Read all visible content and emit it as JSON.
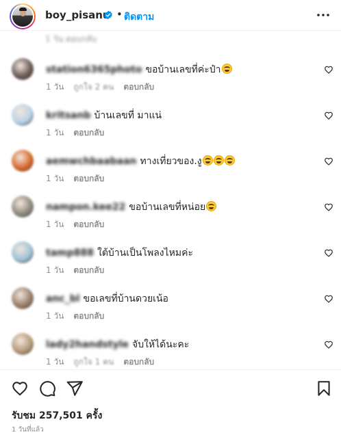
{
  "header": {
    "username": "boy_pisanu",
    "separator": "•",
    "follow_label": "ติดตาม"
  },
  "partial_row": {
    "text": "1 วัน   ตอบกลับ"
  },
  "comments": [
    {
      "username": "station6365photo",
      "text": "ขอบ้านเลขที่ค่ะป๋า",
      "emoji_count": 1,
      "emoji": "heart-eyes-emoji",
      "time": "1 วัน",
      "likes": "ถูกใจ 2 คน",
      "reply": "ตอบกลับ",
      "avatar_color": "#6b5a56"
    },
    {
      "username": "kritsanb",
      "text": "บ้านเลขที่ มาแน่",
      "emoji_count": 0,
      "time": "1 วัน",
      "likes": "",
      "reply": "ตอบกลับ",
      "avatar_color": "#b9d3ea"
    },
    {
      "username": "aemwchbaabaan",
      "text": "ทางเที่ยวของ.งู",
      "emoji_count": 3,
      "emoji": "laughing-emoji",
      "time": "1 วัน",
      "likes": "",
      "reply": "ตอบกลับ",
      "avatar_color": "#d9692a"
    },
    {
      "username": "nampon.kee22",
      "text": "ขอบ้านเลขที่หน่อย",
      "emoji_count": 1,
      "emoji": "laughing-emoji",
      "time": "1 วัน",
      "likes": "",
      "reply": "ตอบกลับ",
      "avatar_color": "#8f8a7e"
    },
    {
      "username": "tamp888",
      "text": "ใต้บ้านเป็นโพลงไหมค่ะ",
      "emoji_count": 0,
      "time": "1 วัน",
      "likes": "",
      "reply": "ตอบกลับ",
      "avatar_color": "#9dc3d6"
    },
    {
      "username": "anc_bl",
      "text": "ขอเลขที่บ้านดวยเน้อ",
      "emoji_count": 0,
      "time": "1 วัน",
      "likes": "",
      "reply": "ตอบกลับ",
      "avatar_color": "#9a7f6a"
    },
    {
      "username": "lady2handstyle",
      "text": "จับให้ได้นะคะ",
      "emoji_count": 0,
      "time": "1 วัน",
      "likes": "ถูกใจ 1 คน",
      "reply": "ตอบกลับ",
      "avatar_color": "#b59a78"
    }
  ],
  "footer": {
    "views": "รับชม 257,501 ครั้ง",
    "time_ago": "1 วันที่แล้ว"
  },
  "colors": {
    "accent": "#0095f6",
    "secondary_text": "#8e8e8e",
    "primary_text": "#262626"
  },
  "icons": {
    "verified": "verified-badge-icon",
    "more": "more-dots-icon",
    "like": "heart-icon",
    "comment": "comment-bubble-icon",
    "share": "paper-plane-icon",
    "save": "bookmark-icon"
  }
}
